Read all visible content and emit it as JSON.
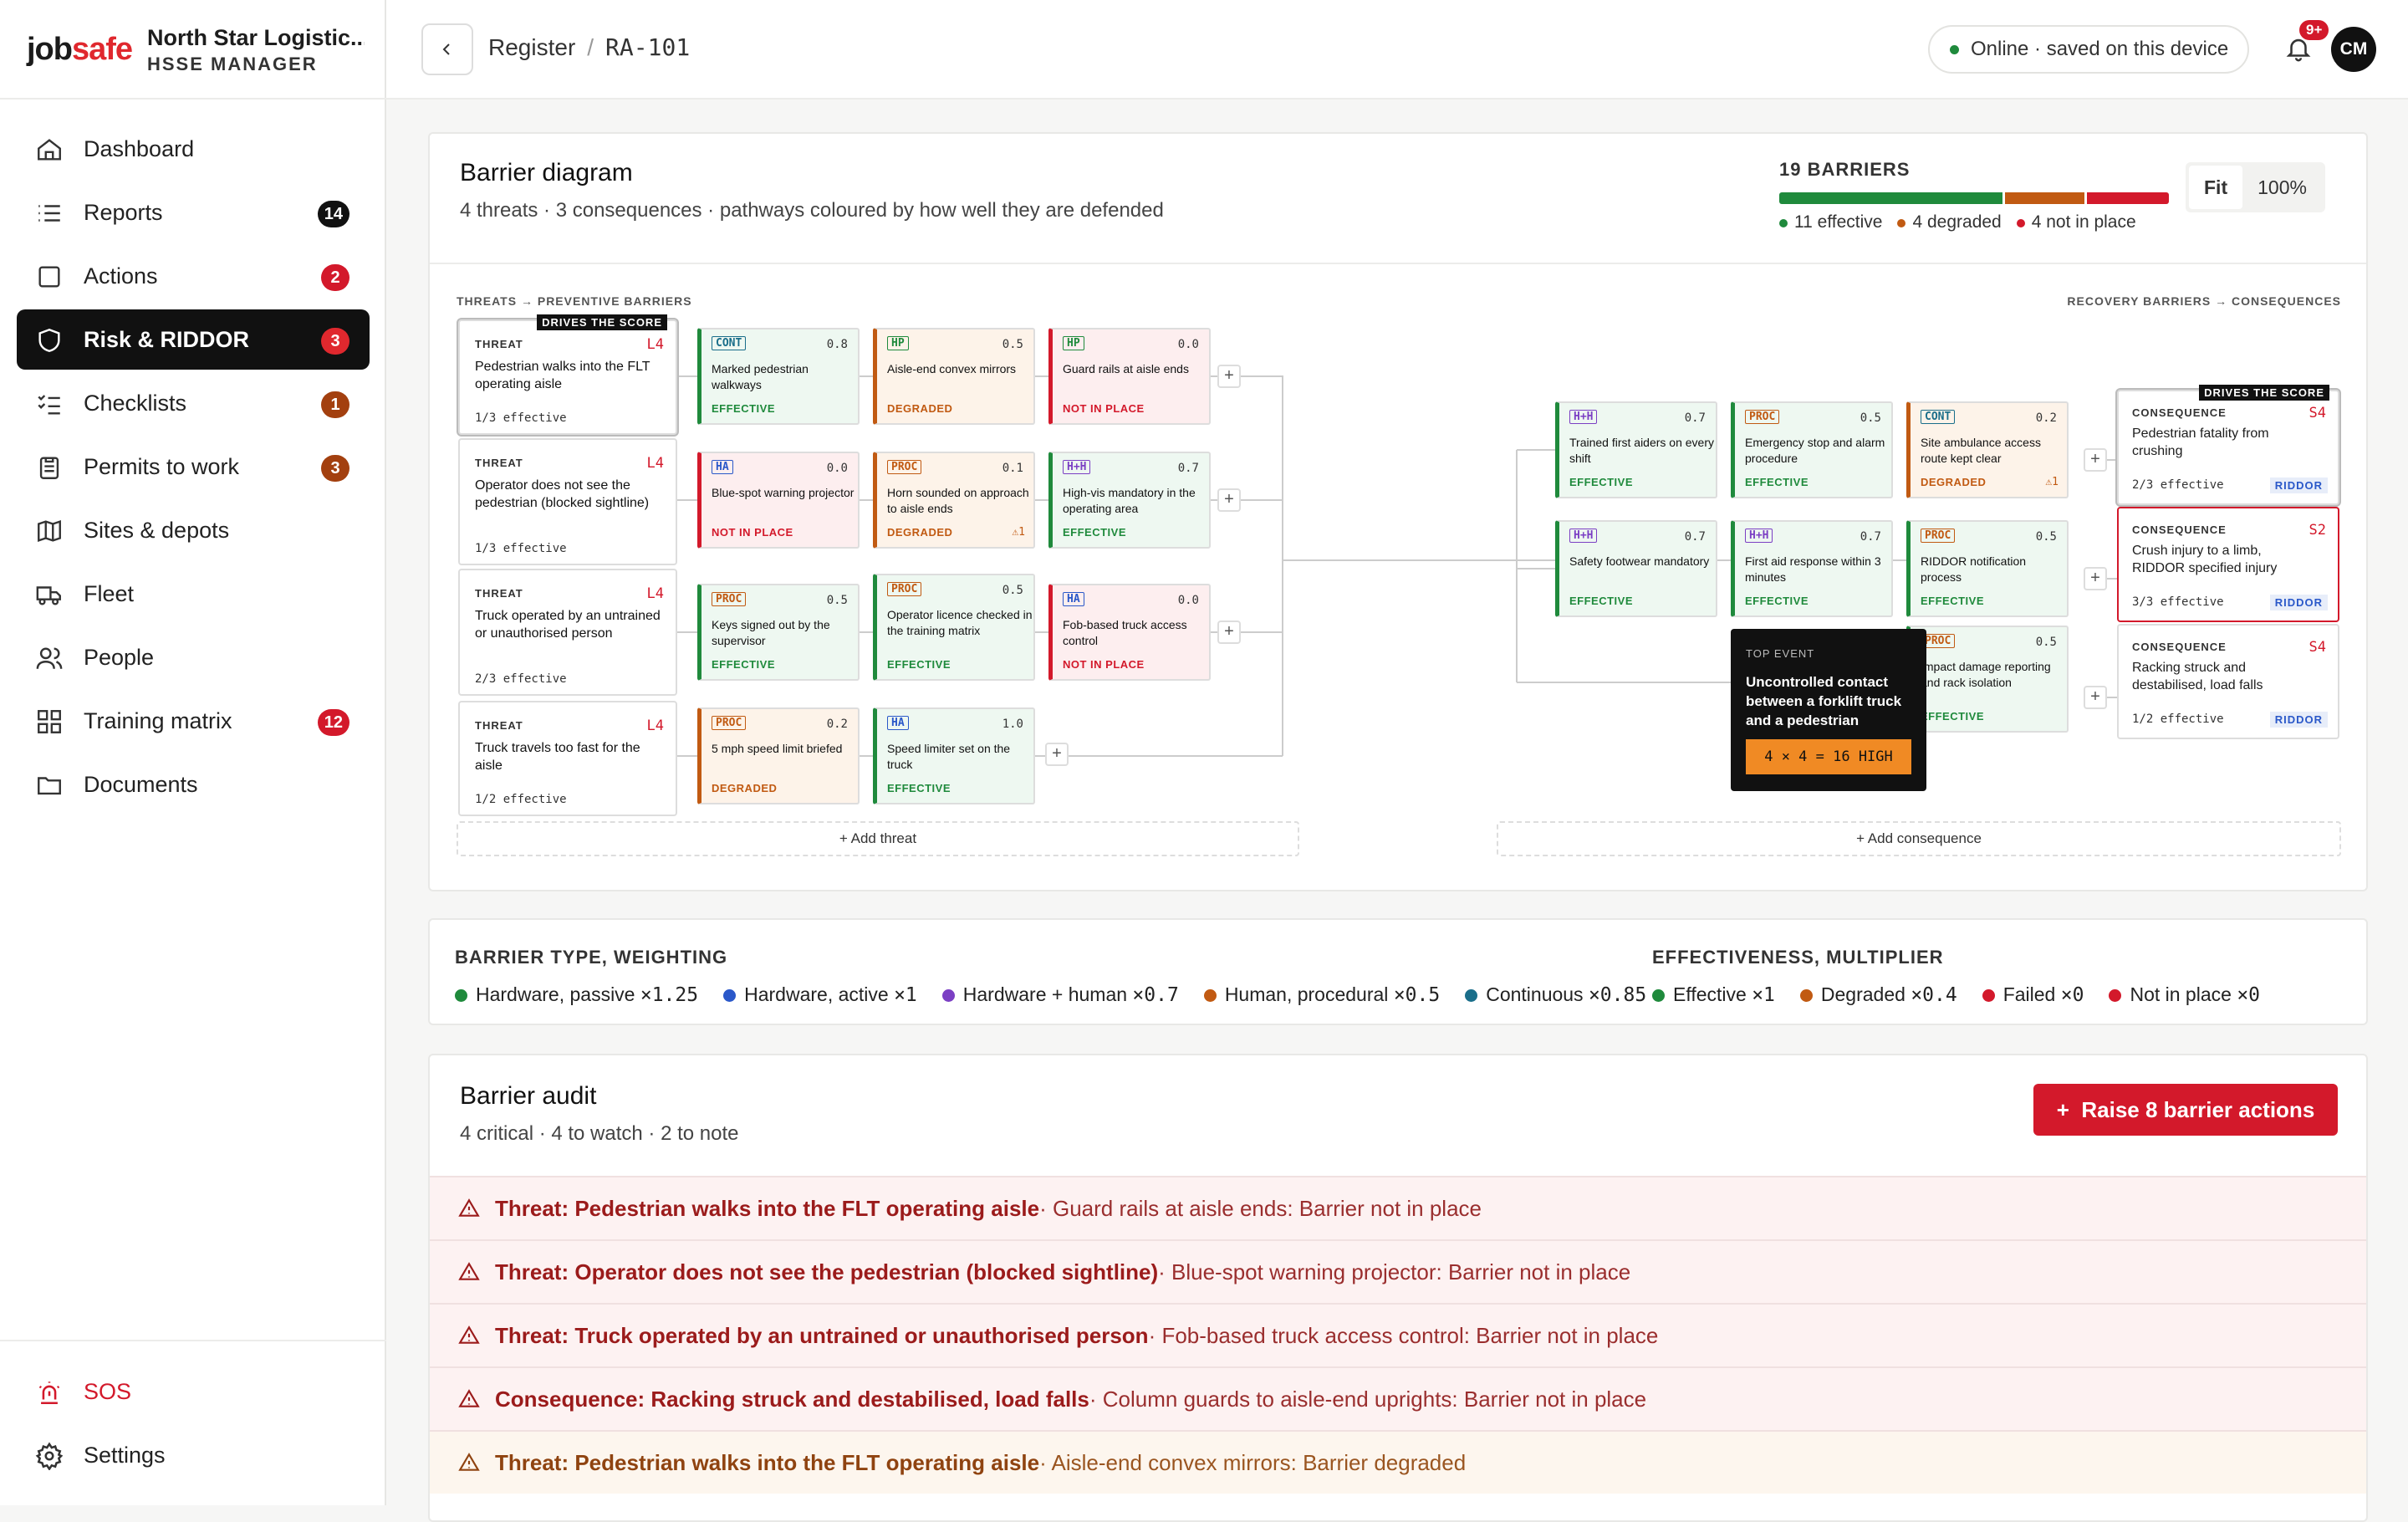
{
  "app": {
    "logo_job": "job",
    "logo_safe": "safe",
    "org": "North Star Logistic...",
    "role": "HSSE MANAGER"
  },
  "nav": [
    {
      "label": "Dashboard",
      "icon": "home-icon",
      "badge": ""
    },
    {
      "label": "Reports",
      "icon": "list-icon",
      "badge": "14",
      "badge_color": "black"
    },
    {
      "label": "Actions",
      "icon": "checkbox-icon",
      "badge": "2",
      "badge_color": "red"
    },
    {
      "label": "Risk & RIDDOR",
      "icon": "shield-icon",
      "badge": "3",
      "badge_color": "red",
      "active": true
    },
    {
      "label": "Checklists",
      "icon": "checklist-icon",
      "badge": "1",
      "badge_color": "brown"
    },
    {
      "label": "Permits to work",
      "icon": "clipboard-icon",
      "badge": "3",
      "badge_color": "brown"
    },
    {
      "label": "Sites & depots",
      "icon": "map-icon",
      "badge": ""
    },
    {
      "label": "Fleet",
      "icon": "truck-icon",
      "badge": ""
    },
    {
      "label": "People",
      "icon": "people-icon",
      "badge": ""
    },
    {
      "label": "Training matrix",
      "icon": "grid-icon",
      "badge": "12",
      "badge_color": "red"
    },
    {
      "label": "Documents",
      "icon": "folder-icon",
      "badge": ""
    }
  ],
  "footer_nav": {
    "sos": "SOS",
    "settings": "Settings"
  },
  "header": {
    "crumb_root": "Register",
    "crumb_sep": "/",
    "crumb_id": "RA-101",
    "status": "Online · saved on this device",
    "notif": "9+",
    "avatar": "CM"
  },
  "diagram": {
    "title": "Barrier diagram",
    "subtitle": "4 threats · 3 consequences · pathways coloured by how well they are defended",
    "summary_label": "19 BARRIERS",
    "eff_label": "11 effective",
    "deg_label": "4 degraded",
    "nip_label": "4 not in place",
    "counts": {
      "effective": 11,
      "degraded": 4,
      "not_in_place": 4
    },
    "zoom_fit": "Fit",
    "zoom_pct": "100%",
    "left_label": "THREATS → PREVENTIVE BARRIERS",
    "right_label": "RECOVERY BARRIERS → CONSEQUENCES",
    "drives": "DRIVES THE SCORE",
    "threat_kw": "THREAT",
    "cons_kw": "CONSEQUENCE",
    "riddor": "RIDDOR",
    "threats": [
      {
        "level": "L4",
        "text": "Pedestrian walks into the FLT operating aisle",
        "eff": "1/3 effective"
      },
      {
        "level": "L4",
        "text": "Operator does not see the pedestrian (blocked sightline)",
        "eff": "1/3 effective"
      },
      {
        "level": "L4",
        "text": "Truck operated by an untrained or unauthorised person",
        "eff": "2/3 effective"
      },
      {
        "level": "L4",
        "text": "Truck travels too fast for the aisle",
        "eff": "1/2 effective"
      }
    ],
    "top_event": {
      "kw": "TOP EVENT",
      "text": "Uncontrolled contact between a forklift truck and a pedestrian",
      "score": "4 × 4 = 16 HIGH"
    },
    "consequences": [
      {
        "level": "S4",
        "text": "Pedestrian fatality from crushing",
        "eff": "2/3 effective"
      },
      {
        "level": "S2",
        "text": "Crush injury to a limb, RIDDOR specified injury",
        "eff": "3/3 effective"
      },
      {
        "level": "S4",
        "text": "Racking struck and destabilised, load falls",
        "eff": "1/2 effective"
      }
    ],
    "barriers": [
      {
        "tag": "CONT",
        "w": "0.8",
        "name": "Marked pedestrian walkways",
        "status": "EFFECTIVE",
        "s": "eff"
      },
      {
        "tag": "HP",
        "w": "0.5",
        "name": "Aisle-end convex mirrors",
        "status": "DEGRADED",
        "s": "deg"
      },
      {
        "tag": "HP",
        "w": "0.0",
        "name": "Guard rails at aisle ends",
        "status": "NOT IN PLACE",
        "s": "nip"
      },
      {
        "tag": "HA",
        "w": "0.0",
        "name": "Blue-spot warning projector",
        "status": "NOT IN PLACE",
        "s": "nip"
      },
      {
        "tag": "PROC",
        "w": "0.1",
        "name": "Horn sounded on approach to aisle ends",
        "status": "DEGRADED",
        "s": "deg",
        "flag": "⚠1"
      },
      {
        "tag": "H+H",
        "w": "0.7",
        "name": "High-vis mandatory in the operating area",
        "status": "EFFECTIVE",
        "s": "eff"
      },
      {
        "tag": "PROC",
        "w": "0.5",
        "name": "Keys signed out by the supervisor",
        "status": "EFFECTIVE",
        "s": "eff"
      },
      {
        "tag": "PROC",
        "w": "0.5",
        "name": "Operator licence checked in the training matrix",
        "status": "EFFECTIVE",
        "s": "eff"
      },
      {
        "tag": "HA",
        "w": "0.0",
        "name": "Fob-based truck access control",
        "status": "NOT IN PLACE",
        "s": "nip"
      },
      {
        "tag": "PROC",
        "w": "0.2",
        "name": "5 mph speed limit briefed",
        "status": "DEGRADED",
        "s": "deg"
      },
      {
        "tag": "HA",
        "w": "1.0",
        "name": "Speed limiter set on the truck",
        "status": "EFFECTIVE",
        "s": "eff"
      },
      {
        "tag": "H+H",
        "w": "0.7",
        "name": "Trained first aiders on every shift",
        "status": "EFFECTIVE",
        "s": "eff"
      },
      {
        "tag": "PROC",
        "w": "0.5",
        "name": "Emergency stop and alarm procedure",
        "status": "EFFECTIVE",
        "s": "eff"
      },
      {
        "tag": "CONT",
        "w": "0.2",
        "name": "Site ambulance access route kept clear",
        "status": "DEGRADED",
        "s": "deg",
        "flag": "⚠1"
      },
      {
        "tag": "H+H",
        "w": "0.7",
        "name": "Safety footwear mandatory",
        "status": "EFFECTIVE",
        "s": "eff"
      },
      {
        "tag": "H+H",
        "w": "0.7",
        "name": "First aid response within 3 minutes",
        "status": "EFFECTIVE",
        "s": "eff"
      },
      {
        "tag": "PROC",
        "w": "0.5",
        "name": "RIDDOR notification process",
        "status": "EFFECTIVE",
        "s": "eff"
      },
      {
        "tag": "HP",
        "w": "0.0",
        "name": "Column guards to aisle-end uprights",
        "status": "NOT IN PLACE",
        "s": "nip"
      },
      {
        "tag": "PROC",
        "w": "0.5",
        "name": "Impact damage reporting and rack isolation",
        "status": "EFFECTIVE",
        "s": "eff"
      }
    ],
    "add_threat": "Add threat",
    "add_consequence": "Add consequence"
  },
  "key": {
    "type_title": "BARRIER TYPE, WEIGHTING",
    "eff_title": "EFFECTIVENESS, MULTIPLIER",
    "types": [
      {
        "label": "Hardware, passive",
        "mult": "×1.25",
        "color": "#1f8a3c"
      },
      {
        "label": "Hardware, active",
        "mult": "×1",
        "color": "#2a58c9"
      },
      {
        "label": "Hardware + human",
        "mult": "×0.7",
        "color": "#7b3fc4"
      },
      {
        "label": "Human, procedural",
        "mult": "×0.5",
        "color": "#c15a12"
      },
      {
        "label": "Continuous",
        "mult": "×0.85",
        "color": "#1a6e8a"
      }
    ],
    "effs": [
      {
        "label": "Effective",
        "mult": "×1",
        "color": "#1f8a3c"
      },
      {
        "label": "Degraded",
        "mult": "×0.4",
        "color": "#c15a12"
      },
      {
        "label": "Failed",
        "mult": "×0",
        "color": "#d3192b"
      },
      {
        "label": "Not in place",
        "mult": "×0",
        "color": "#d3192b"
      }
    ]
  },
  "audit": {
    "title": "Barrier audit",
    "subtitle": "4 critical · 4 to watch · 2 to note",
    "raise": "Raise 8 barrier actions",
    "rows": [
      {
        "head": "Threat: Pedestrian walks into the FLT operating aisle",
        "rest": " · Guard rails at aisle ends: Barrier not in place",
        "kind": "crit"
      },
      {
        "head": "Threat: Operator does not see the pedestrian (blocked sightline)",
        "rest": " · Blue-spot warning projector: Barrier not in place",
        "kind": "crit"
      },
      {
        "head": "Threat: Truck operated by an untrained or unauthorised person",
        "rest": " · Fob-based truck access control: Barrier not in place",
        "kind": "crit"
      },
      {
        "head": "Consequence: Racking struck and destabilised, load falls",
        "rest": " · Column guards to aisle-end uprights: Barrier not in place",
        "kind": "crit"
      },
      {
        "head": "Threat: Pedestrian walks into the FLT operating aisle",
        "rest": " · Aisle-end convex mirrors: Barrier degraded",
        "kind": "watch"
      }
    ]
  }
}
